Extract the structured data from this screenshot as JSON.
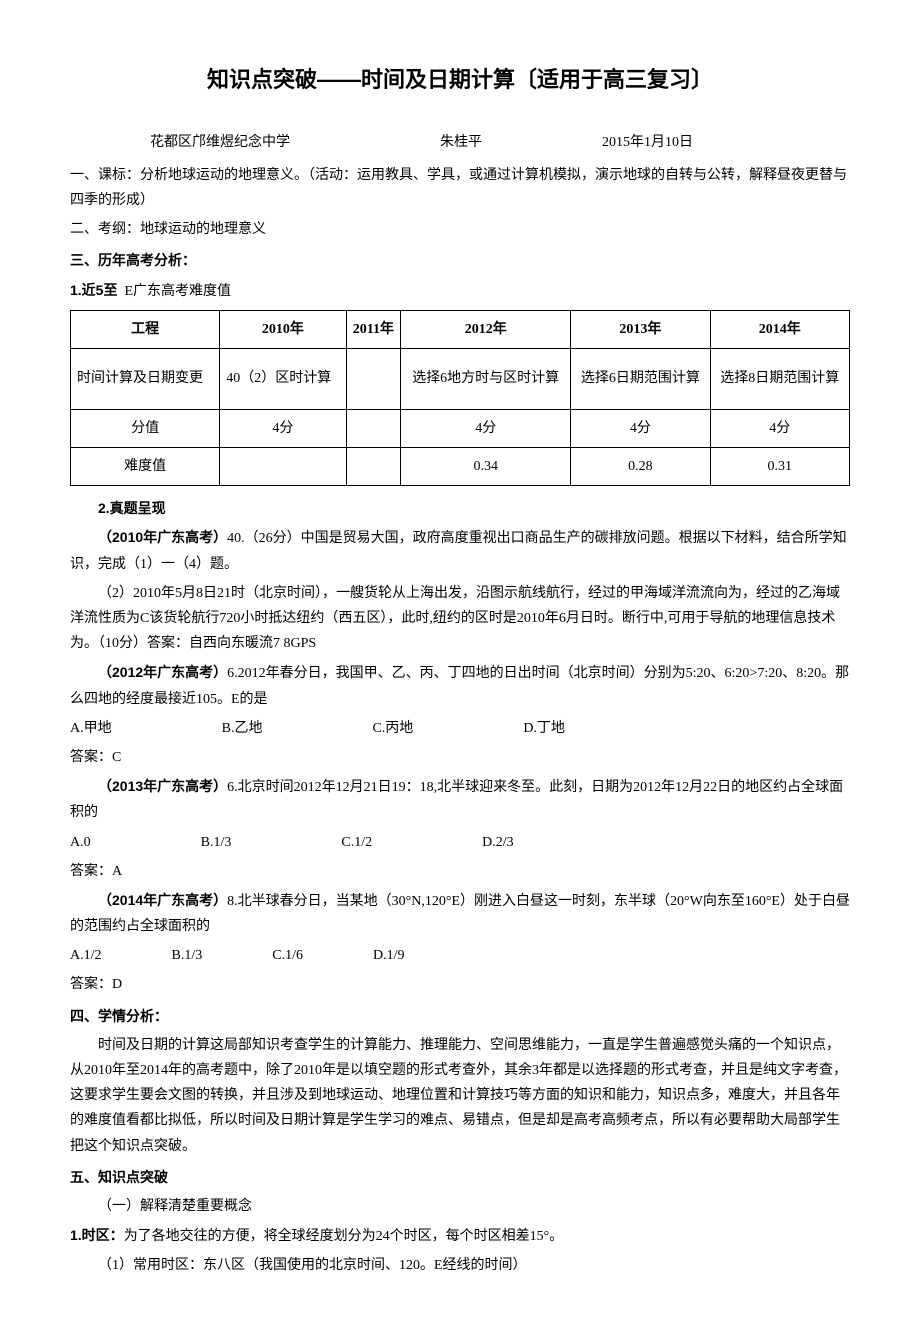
{
  "title": "知识点突破——时间及日期计算〔适用于高三复习〕",
  "meta": {
    "school": "花都区邝维煜纪念中学",
    "author": "朱桂平",
    "date": "2015年1月10日"
  },
  "sec1": {
    "label": "一、课标：",
    "text": "分析地球运动的地理意义。（活动：运用教具、学具，或通过计算机模拟，演示地球的自转与公转，解释昼夜更替与四季的形成）"
  },
  "sec2": {
    "label": "二、考纲：",
    "text": "地球运动的地理意义"
  },
  "sec3": {
    "label": "三、历年高考分析：",
    "sub1_label": "1.近5至",
    "sub1_text": "E广东高考难度值"
  },
  "table": {
    "headers": [
      "工程",
      "2010年",
      "2011年",
      "2012年",
      "2013年",
      "2014年"
    ],
    "rows": [
      [
        "时间计算及日期变更",
        "40（2）区时计算",
        "",
        "选择6地方时与区时计算",
        "选择6日期范围计算",
        "选择8日期范围计算"
      ],
      [
        "分值",
        "4分",
        "",
        "4分",
        "4分",
        "4分"
      ],
      [
        "难度值",
        "",
        "",
        "0.34",
        "0.28",
        "0.31"
      ]
    ]
  },
  "sub2_label": "2.真题呈现",
  "q2010": {
    "tag": "（2010年广东高考）",
    "head": "40.（26分）中国是贸易大国，政府高度重视出口商品生产的碳排放问题。根据以下材料，结合所学知识，完成（1）一（4）题。",
    "body": "（2）2010年5月8日21时（北京时间），一艘货轮从上海出发，沿图示航线航行，经过的甲海域洋流流向为，经过的乙海域洋流性质为C该货轮航行720小时抵达纽约（西五区），此时,纽约的区时是2010年6月日时。断行中,可用于导航的地理信息技术为。（10分）答案：自西向东暖流7 8GPS"
  },
  "q2012": {
    "tag": "（2012年广东高考）",
    "head": "6.2012年春分日，我国甲、乙、丙、丁四地的日出时间（北京时间）分别为5:20、6:20>7:20、8:20。那么四地的经度最接近105。E的是",
    "opts": {
      "a": "A.甲地",
      "b": "B.乙地",
      "c": "C.丙地",
      "d": "D.丁地"
    },
    "ans": "答案：C"
  },
  "q2013": {
    "tag": "（2013年广东高考）",
    "head": "6.北京时间2012年12月21日19：18,北半球迎来冬至。此刻，日期为2012年12月22日的地区约占全球面积的",
    "opts": {
      "a": "A.0",
      "b": "B.1/3",
      "c": "C.1/2",
      "d": "D.2/3"
    },
    "ans": "答案：A"
  },
  "q2014": {
    "tag": "（2014年广东高考）",
    "head": "8.北半球春分日，当某地（30°N,120°E）刚进入白昼这一时刻，东半球（20°W向东至160°E）处于白昼的范围约占全球面积的",
    "opts": {
      "a": "A.1/2",
      "b": "B.1/3",
      "c": "C.1/6",
      "d": "D.1/9"
    },
    "ans": "答案：D"
  },
  "sec4": {
    "label": "四、学情分析：",
    "body": "时间及日期的计算这局部知识考查学生的计算能力、推理能力、空间思维能力，一直是学生普遍感觉头痛的一个知识点，从2010年至2014年的高考题中，除了2010年是以填空题的形式考查外，其余3年都是以选择题的形式考查，并且是纯文字考查，这要求学生要会文图的转换，并且涉及到地球运动、地理位置和计算技巧等方面的知识和能力，知识点多，难度大，并且各年的难度值看都比拟低，所以时间及日期计算是学生学习的难点、易错点，但是却是高考高频考点，所以有必要帮助大局部学生把这个知识点突破。"
  },
  "sec5": {
    "label": "五、知识点突破",
    "sub1": "（一）解释清楚重要概念",
    "p1_label": "1.时区：",
    "p1_text": "为了各地交往的方便，将全球经度划分为24个时区，每个时区相差15°。",
    "p2": "（1）常用时区：东八区（我国使用的北京时间、120。E经线的时间）"
  }
}
